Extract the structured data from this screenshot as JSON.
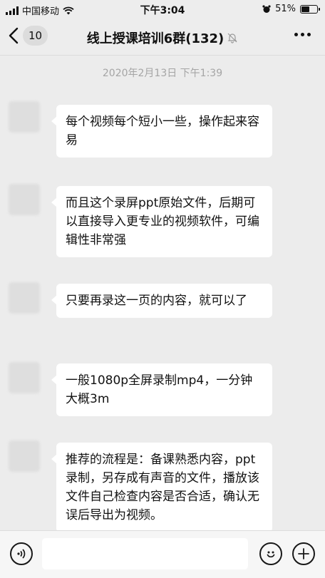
{
  "status_bar": {
    "carrier": "中国移动",
    "time": "下午3:04",
    "battery_percent": "51%",
    "battery_level": 0.51
  },
  "nav": {
    "unread_count": "10",
    "title": "线上授课培训6群(132)"
  },
  "chat": {
    "timestamp": "2020年2月13日 下午1:39",
    "messages": [
      {
        "text": "每个视频每个短小一些，操作起来容易"
      },
      {
        "text": "而且这个录屏ppt原始文件，后期可以直接导入更专业的视频软件，可编辑性非常强"
      },
      {
        "text": "只要再录这一页的内容，就可以了"
      },
      {
        "text": "一般1080p全屏录制mp4，一分钟大概3m"
      },
      {
        "text": "推荐的流程是：备课熟悉内容，ppt录制，另存成有声音的文件，播放该文件自己检查内容是否合适，确认无误后导出为视频。"
      }
    ]
  },
  "input_bar": {
    "placeholder": ""
  }
}
